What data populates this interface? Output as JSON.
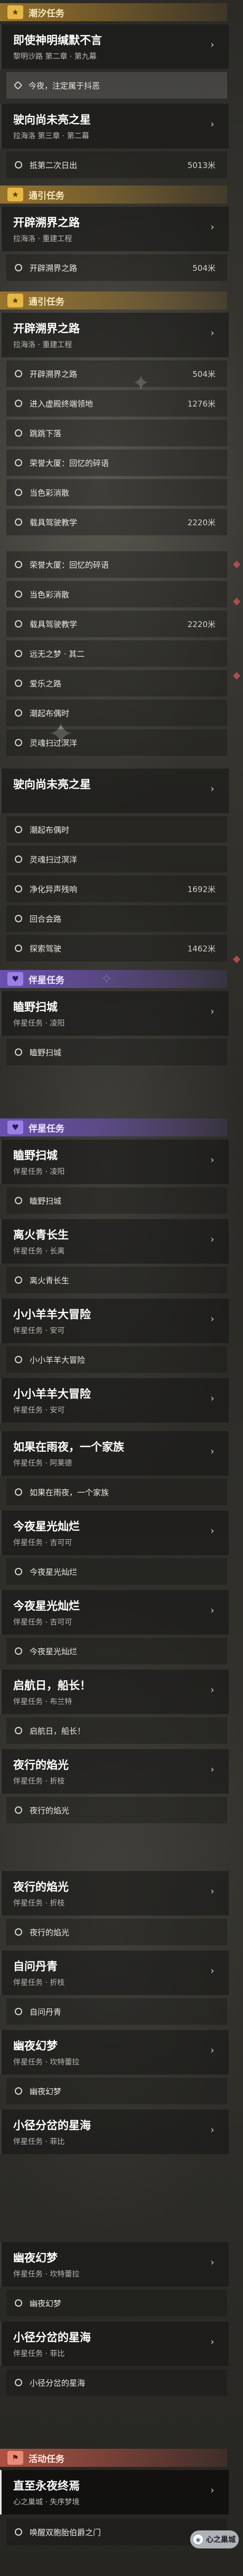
{
  "colors": {
    "daily": "#e6b844",
    "companion": "#9a7fe6",
    "event": "#e98b78",
    "marker": "#c74f57"
  },
  "icons": {
    "category_daily": "star-icon",
    "category_companion": "heart-icon",
    "category_event": "flag-icon",
    "step_pending": "circle-icon",
    "step_active": "diamond-icon",
    "chevron": "chevron-right-icon"
  },
  "categories": {
    "c1": "潮汐任务",
    "c2": "通引任务",
    "c3": "通引任务",
    "c4": "伴星任务",
    "c5": "伴星任务",
    "c6": "活动任务"
  },
  "quests": {
    "q1": {
      "title": "即使神明缄默不言",
      "sub": "黎明沙路 第二章 · 第九幕"
    },
    "q2": {
      "title": "驶向尚未亮之星",
      "sub": "拉海洛 第三章 · 第二幕"
    },
    "q3": {
      "title": "开辟溯界之路",
      "sub": "拉海洛 · 重建工程"
    },
    "q4": {
      "title": "开辟溯界之路",
      "sub": "拉海洛 · 重建工程"
    },
    "q5": {
      "title": "驶向尚未亮之星",
      "sub": ""
    },
    "q6": {
      "title": "瞌野扫城",
      "sub": "伴星任务 · 凌阳"
    },
    "q7": {
      "title": "瞌野扫城",
      "sub": "伴星任务 · 凌阳"
    },
    "q8": {
      "title": "离火青长生",
      "sub": "伴星任务 · 长离"
    },
    "q9": {
      "title": "小小羊羊大冒险",
      "sub": "伴星任务 · 安可"
    },
    "q10": {
      "title": "小小羊羊大冒险",
      "sub": "伴星任务 · 安可"
    },
    "q11": {
      "title": "如果在雨夜，一个家族",
      "sub": "伴星任务 · 阿莱德"
    },
    "q12": {
      "title": "今夜星光灿烂",
      "sub": "伴星任务 · 吉可可"
    },
    "q13": {
      "title": "今夜星光灿烂",
      "sub": "伴星任务 · 吉可可"
    },
    "q14": {
      "title": "启航日，船长！",
      "sub": "伴星任务 · 布兰特"
    },
    "q15": {
      "title": "夜行的焰光",
      "sub": "伴星任务 · 折枝"
    },
    "q16": {
      "title": "夜行的焰光",
      "sub": "伴星任务 · 折枝"
    },
    "q17": {
      "title": "自问丹青",
      "sub": "伴星任务 · 折枝"
    },
    "q18": {
      "title": "幽夜幻梦",
      "sub": "伴星任务 · 坎特蕾拉"
    },
    "q19": {
      "title": "小径分岔的星海",
      "sub": "伴星任务 · 菲比"
    },
    "q20": {
      "title": "幽夜幻梦",
      "sub": "伴星任务 · 坎特蕾拉"
    },
    "q21": {
      "title": "小径分岔的星海",
      "sub": "伴星任务 · 菲比"
    },
    "q22": {
      "title": "直至永夜终焉",
      "sub": "心之巢城 · 失序梦境"
    }
  },
  "steps": {
    "s1": {
      "label": "今夜，注定属于抖恶",
      "dist": ""
    },
    "s2": {
      "label": "抵第二次日出",
      "dist": "5013米"
    },
    "s3": {
      "label": "开辟溯界之路",
      "dist": "504米"
    },
    "s4": {
      "label": "开辟溯界之路",
      "dist": "504米"
    },
    "s5": {
      "label": "进入虚殿终端领地",
      "dist": "1276米"
    },
    "s6": {
      "label": "跳跳下落",
      "dist": ""
    },
    "s7": {
      "label": "荣誉大厦：回忆的碎语",
      "dist": ""
    },
    "s8": {
      "label": "当色彩消散",
      "dist": ""
    },
    "s9": {
      "label": "载具驾驶教学",
      "dist": "2220米"
    },
    "s10": {
      "label": "荣誉大厦：回忆的碎语",
      "dist": ""
    },
    "s11": {
      "label": "当色彩消散",
      "dist": ""
    },
    "s12": {
      "label": "载具驾驶教学",
      "dist": "2220米"
    },
    "s13": {
      "label": "远无之梦 · 其二",
      "dist": ""
    },
    "s14": {
      "label": "爱乐之路",
      "dist": ""
    },
    "s15": {
      "label": "潮起布偶时",
      "dist": ""
    },
    "s16": {
      "label": "灵魂扫过溟洋",
      "dist": ""
    },
    "s17": {
      "label": "潮起布偶时",
      "dist": ""
    },
    "s18": {
      "label": "灵魂扫过溟洋",
      "dist": ""
    },
    "s19": {
      "label": "净化异声残响",
      "dist": "1692米"
    },
    "s20": {
      "label": "回合会路",
      "dist": ""
    },
    "s21": {
      "label": "探索驾驶",
      "dist": "1462米"
    },
    "s22": {
      "label": "瞌野扫城",
      "dist": ""
    },
    "s23": {
      "label": "瞌野扫城",
      "dist": ""
    },
    "s24": {
      "label": "离火青长生",
      "dist": ""
    },
    "s25": {
      "label": "小小羊羊大冒险",
      "dist": ""
    },
    "s26": {
      "label": "如果在雨夜，一个家族",
      "dist": ""
    },
    "s27": {
      "label": "今夜星光灿烂",
      "dist": ""
    },
    "s28": {
      "label": "今夜星光灿烂",
      "dist": ""
    },
    "s29": {
      "label": "启航日，船长！",
      "dist": ""
    },
    "s30": {
      "label": "夜行的焰光",
      "dist": ""
    },
    "s31": {
      "label": "夜行的焰光",
      "dist": ""
    },
    "s32": {
      "label": "自问丹青",
      "dist": ""
    },
    "s33": {
      "label": "幽夜幻梦",
      "dist": ""
    },
    "s34": {
      "label": "小径分岔的星海",
      "dist": ""
    },
    "s35": {
      "label": "幽夜幻梦",
      "dist": ""
    },
    "s36": {
      "label": "小径分岔的星海",
      "dist": ""
    },
    "s37": {
      "label": "唤醒双胞胎伯爵之门",
      "dist": ""
    }
  },
  "floating_button": {
    "label": "心之巢城",
    "icon": "portal-icon"
  }
}
